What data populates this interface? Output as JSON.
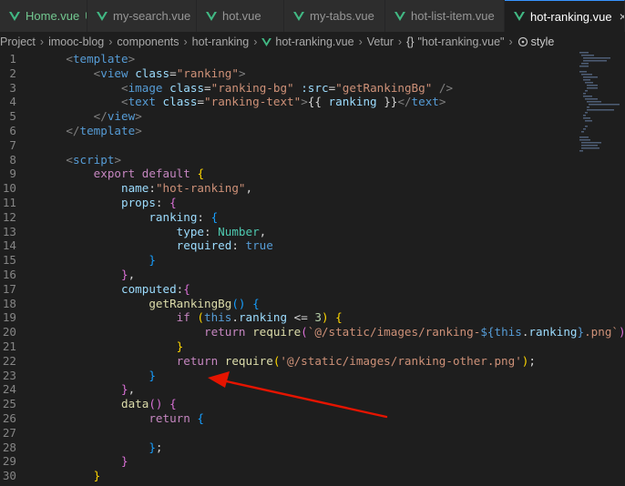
{
  "tabs": [
    {
      "label": "Home.vue",
      "status": "U"
    },
    {
      "label": "my-search.vue"
    },
    {
      "label": "hot.vue"
    },
    {
      "label": "my-tabs.vue"
    },
    {
      "label": "hot-list-item.vue"
    },
    {
      "label": "hot-ranking.vue",
      "close": "×"
    }
  ],
  "breadcrumb": {
    "items": [
      "Project",
      "imooc-blog",
      "components",
      "hot-ranking"
    ],
    "file": "hot-ranking.vue",
    "vetur": "Vetur",
    "braces": "{}",
    "component": "\"hot-ranking.vue\"",
    "style": "style"
  },
  "colors": {
    "tag": "#569cd6",
    "attr": "#9cdcfe",
    "string": "#ce9178",
    "keyword": "#c586c0",
    "function": "#dcdcaa",
    "type": "#4ec9b0",
    "bracket": "#ffd700",
    "bracket2": "#da70d6",
    "bracket3": "#179fff",
    "plain": "#d4d4d4",
    "arrow": "#e51400",
    "vue_green": "#41b883"
  },
  "code_lines": [
    {
      "n": "1",
      "tokens": [
        [
          "    ",
          "p"
        ],
        [
          "<",
          "g"
        ],
        [
          "template",
          "t"
        ],
        [
          ">",
          "g"
        ]
      ]
    },
    {
      "n": "2",
      "tokens": [
        [
          "        ",
          "p"
        ],
        [
          "<",
          "g"
        ],
        [
          "view",
          "t"
        ],
        [
          " ",
          "p"
        ],
        [
          "class",
          "a"
        ],
        [
          "=",
          "p"
        ],
        [
          "\"ranking\"",
          "s"
        ],
        [
          ">",
          "g"
        ]
      ]
    },
    {
      "n": "3",
      "tokens": [
        [
          "            ",
          "p"
        ],
        [
          "<",
          "g"
        ],
        [
          "image",
          "t"
        ],
        [
          " ",
          "p"
        ],
        [
          "class",
          "a"
        ],
        [
          "=",
          "p"
        ],
        [
          "\"ranking-bg\"",
          "s"
        ],
        [
          " ",
          "p"
        ],
        [
          ":src",
          "a"
        ],
        [
          "=",
          "p"
        ],
        [
          "\"getRankingBg\"",
          "s"
        ],
        [
          " />",
          "g"
        ]
      ]
    },
    {
      "n": "4",
      "tokens": [
        [
          "            ",
          "p"
        ],
        [
          "<",
          "g"
        ],
        [
          "text",
          "t"
        ],
        [
          " ",
          "p"
        ],
        [
          "class",
          "a"
        ],
        [
          "=",
          "p"
        ],
        [
          "\"ranking-text\"",
          "s"
        ],
        [
          ">",
          "g"
        ],
        [
          "{{ ",
          "p"
        ],
        [
          "ranking",
          "a"
        ],
        [
          " }}",
          "p"
        ],
        [
          "</",
          "g"
        ],
        [
          "text",
          "t"
        ],
        [
          ">",
          "g"
        ]
      ]
    },
    {
      "n": "5",
      "tokens": [
        [
          "        ",
          "p"
        ],
        [
          "</",
          "g"
        ],
        [
          "view",
          "t"
        ],
        [
          ">",
          "g"
        ]
      ]
    },
    {
      "n": "6",
      "tokens": [
        [
          "    ",
          "p"
        ],
        [
          "</",
          "g"
        ],
        [
          "template",
          "t"
        ],
        [
          ">",
          "g"
        ]
      ]
    },
    {
      "n": "7",
      "tokens": [
        [
          "",
          "p"
        ]
      ]
    },
    {
      "n": "8",
      "tokens": [
        [
          "    ",
          "p"
        ],
        [
          "<",
          "g"
        ],
        [
          "script",
          "t"
        ],
        [
          ">",
          "g"
        ]
      ]
    },
    {
      "n": "9",
      "tokens": [
        [
          "        ",
          "p"
        ],
        [
          "export",
          "k"
        ],
        [
          " ",
          "p"
        ],
        [
          "default",
          "k"
        ],
        [
          " ",
          "p"
        ],
        [
          "{",
          "y"
        ]
      ]
    },
    {
      "n": "10",
      "tokens": [
        [
          "            ",
          "p"
        ],
        [
          "name",
          "a"
        ],
        [
          ":",
          "p"
        ],
        [
          "\"hot-ranking\"",
          "s"
        ],
        [
          ",",
          "p"
        ]
      ]
    },
    {
      "n": "11",
      "tokens": [
        [
          "            ",
          "p"
        ],
        [
          "props",
          "a"
        ],
        [
          ": ",
          "p"
        ],
        [
          "{",
          "m"
        ]
      ]
    },
    {
      "n": "12",
      "tokens": [
        [
          "                ",
          "p"
        ],
        [
          "ranking",
          "a"
        ],
        [
          ": ",
          "p"
        ],
        [
          "{",
          "b"
        ]
      ]
    },
    {
      "n": "13",
      "tokens": [
        [
          "                    ",
          "p"
        ],
        [
          "type",
          "a"
        ],
        [
          ": ",
          "p"
        ],
        [
          "Number",
          "c"
        ],
        [
          ",",
          "p"
        ]
      ]
    },
    {
      "n": "14",
      "tokens": [
        [
          "                    ",
          "p"
        ],
        [
          "required",
          "a"
        ],
        [
          ": ",
          "p"
        ],
        [
          "true",
          "t"
        ]
      ]
    },
    {
      "n": "15",
      "tokens": [
        [
          "                ",
          "p"
        ],
        [
          "}",
          "b"
        ]
      ]
    },
    {
      "n": "16",
      "tokens": [
        [
          "            ",
          "p"
        ],
        [
          "}",
          "m"
        ],
        [
          ",",
          "p"
        ]
      ]
    },
    {
      "n": "17",
      "tokens": [
        [
          "            ",
          "p"
        ],
        [
          "computed",
          "a"
        ],
        [
          ":",
          "p"
        ],
        [
          "{",
          "m"
        ]
      ]
    },
    {
      "n": "18",
      "tokens": [
        [
          "                ",
          "p"
        ],
        [
          "getRankingBg",
          "f"
        ],
        [
          "()",
          "b"
        ],
        [
          " ",
          "p"
        ],
        [
          "{",
          "b"
        ]
      ]
    },
    {
      "n": "19",
      "tokens": [
        [
          "                    ",
          "p"
        ],
        [
          "if",
          "k"
        ],
        [
          " ",
          "p"
        ],
        [
          "(",
          "y"
        ],
        [
          "this",
          "t"
        ],
        [
          ".",
          "p"
        ],
        [
          "ranking",
          "a"
        ],
        [
          " <= ",
          "p"
        ],
        [
          "3",
          "n"
        ],
        [
          ")",
          "y"
        ],
        [
          " ",
          "p"
        ],
        [
          "{",
          "y"
        ]
      ]
    },
    {
      "n": "20",
      "tokens": [
        [
          "                        ",
          "p"
        ],
        [
          "return",
          "k"
        ],
        [
          " ",
          "p"
        ],
        [
          "require",
          "f"
        ],
        [
          "(",
          "m"
        ],
        [
          "`@/static/images/ranking-",
          "s"
        ],
        [
          "${",
          "t"
        ],
        [
          "this",
          "t"
        ],
        [
          ".",
          "p"
        ],
        [
          "ranking",
          "a"
        ],
        [
          "}",
          "t"
        ],
        [
          ".png`",
          "s"
        ],
        [
          ")",
          "m"
        ],
        [
          ";",
          "p"
        ]
      ]
    },
    {
      "n": "21",
      "tokens": [
        [
          "                    ",
          "p"
        ],
        [
          "}",
          "y"
        ]
      ]
    },
    {
      "n": "22",
      "tokens": [
        [
          "                    ",
          "p"
        ],
        [
          "return",
          "k"
        ],
        [
          " ",
          "p"
        ],
        [
          "require",
          "f"
        ],
        [
          "(",
          "y"
        ],
        [
          "'@/static/images/ranking-other.png'",
          "s"
        ],
        [
          ")",
          "y"
        ],
        [
          ";",
          "p"
        ]
      ]
    },
    {
      "n": "23",
      "tokens": [
        [
          "                ",
          "p"
        ],
        [
          "}",
          "b"
        ]
      ]
    },
    {
      "n": "24",
      "tokens": [
        [
          "            ",
          "p"
        ],
        [
          "}",
          "m"
        ],
        [
          ",",
          "p"
        ]
      ]
    },
    {
      "n": "25",
      "tokens": [
        [
          "            ",
          "p"
        ],
        [
          "data",
          "f"
        ],
        [
          "()",
          "m"
        ],
        [
          " ",
          "p"
        ],
        [
          "{",
          "m"
        ]
      ]
    },
    {
      "n": "26",
      "tokens": [
        [
          "                ",
          "p"
        ],
        [
          "return",
          "k"
        ],
        [
          " ",
          "p"
        ],
        [
          "{",
          "b"
        ]
      ]
    },
    {
      "n": "27",
      "tokens": [
        [
          "",
          "p"
        ]
      ]
    },
    {
      "n": "28",
      "tokens": [
        [
          "                ",
          "p"
        ],
        [
          "}",
          "b"
        ],
        [
          ";",
          "p"
        ]
      ]
    },
    {
      "n": "29",
      "tokens": [
        [
          "            ",
          "p"
        ],
        [
          "}",
          "m"
        ]
      ]
    },
    {
      "n": "30",
      "tokens": [
        [
          "        ",
          "p"
        ],
        [
          "}",
          "y"
        ]
      ]
    }
  ]
}
